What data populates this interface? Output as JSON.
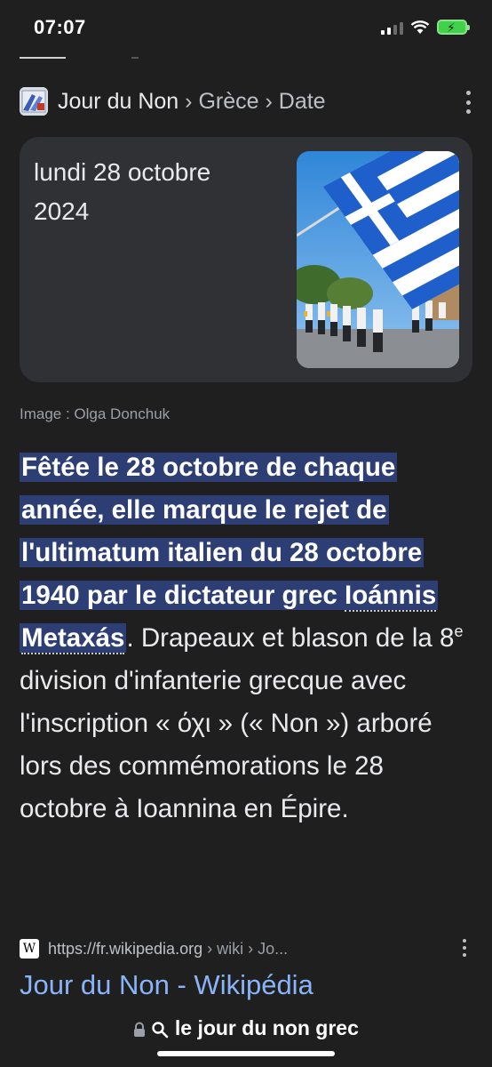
{
  "status": {
    "time": "07:07"
  },
  "header": {
    "crumb_1": "Jour du Non",
    "crumb_2": "Grèce",
    "crumb_3": "Date",
    "separator": "›"
  },
  "card": {
    "date": "lundi 28 octobre 2024"
  },
  "image_credit": "Image : Olga Donchuk",
  "snippet": {
    "highlight_1": "Fêtée le 28 octobre de chaque année, elle marque le rejet de l'ultimatum italien du 28 octobre 1940 par le dictateur grec ",
    "highlight_link": "Ioánnis Metaxás",
    "rest_1": ". Drapeaux et blason de la 8",
    "superscript": "e",
    "rest_2": " division d'infanterie grecque avec l'inscription « όχι » (« Non ») arboré lors des commémorations le 28 octobre à Ioannina en Épire."
  },
  "source": {
    "favicon_letter": "W",
    "url": "https://fr.wikipedia.org",
    "crumbs": " › wiki › Jo...",
    "title": "Jour du Non - Wikipédia"
  },
  "address_bar": {
    "query": "le jour du non grec"
  },
  "colors": {
    "background": "#1f1f1f",
    "card": "#303134",
    "highlight": "#2d3e74",
    "link": "#8ab4f8"
  }
}
